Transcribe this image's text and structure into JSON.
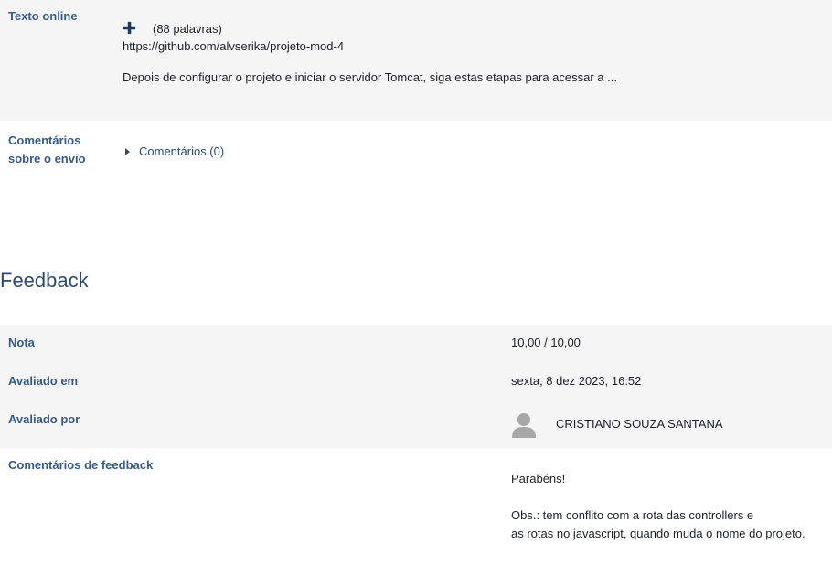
{
  "submission": {
    "online_text_label": "Texto online",
    "expand_icon": "plus-icon",
    "expand_glyph": "✚",
    "word_count": "(88 palavras)",
    "link": "https://github.com/alvserika/projeto-mod-4",
    "excerpt": "Depois de configurar o projeto e iniciar o servidor Tomcat, siga estas etapas para acessar a ...",
    "comments_label_line1": "Comentários",
    "comments_label_line2": "sobre o envio",
    "comments_toggle": "Comentários (0)"
  },
  "feedback": {
    "heading": "Feedback",
    "grade_label": "Nota",
    "grade_value": "10,00 / 10,00",
    "graded_on_label": "Avaliado em",
    "graded_on_value": "sexta, 8 dez 2023, 16:52",
    "graded_by_label": "Avaliado por",
    "grader_name": "CRISTIANO SOUZA SANTANA",
    "grader_avatar_icon": "user-avatar-icon",
    "comments_label": "Comentários de feedback",
    "comment_line1": "Parabéns!",
    "comment_line2": "Obs.: tem conflito com a rota das controllers e",
    "comment_line3": "as rotas no javascript, quando muda o nome do projeto."
  },
  "colors": {
    "label": "#375a8a",
    "row_bg": "#f5f5f5",
    "heading": "#2c4a6e",
    "avatar": "#a6a6a6"
  }
}
